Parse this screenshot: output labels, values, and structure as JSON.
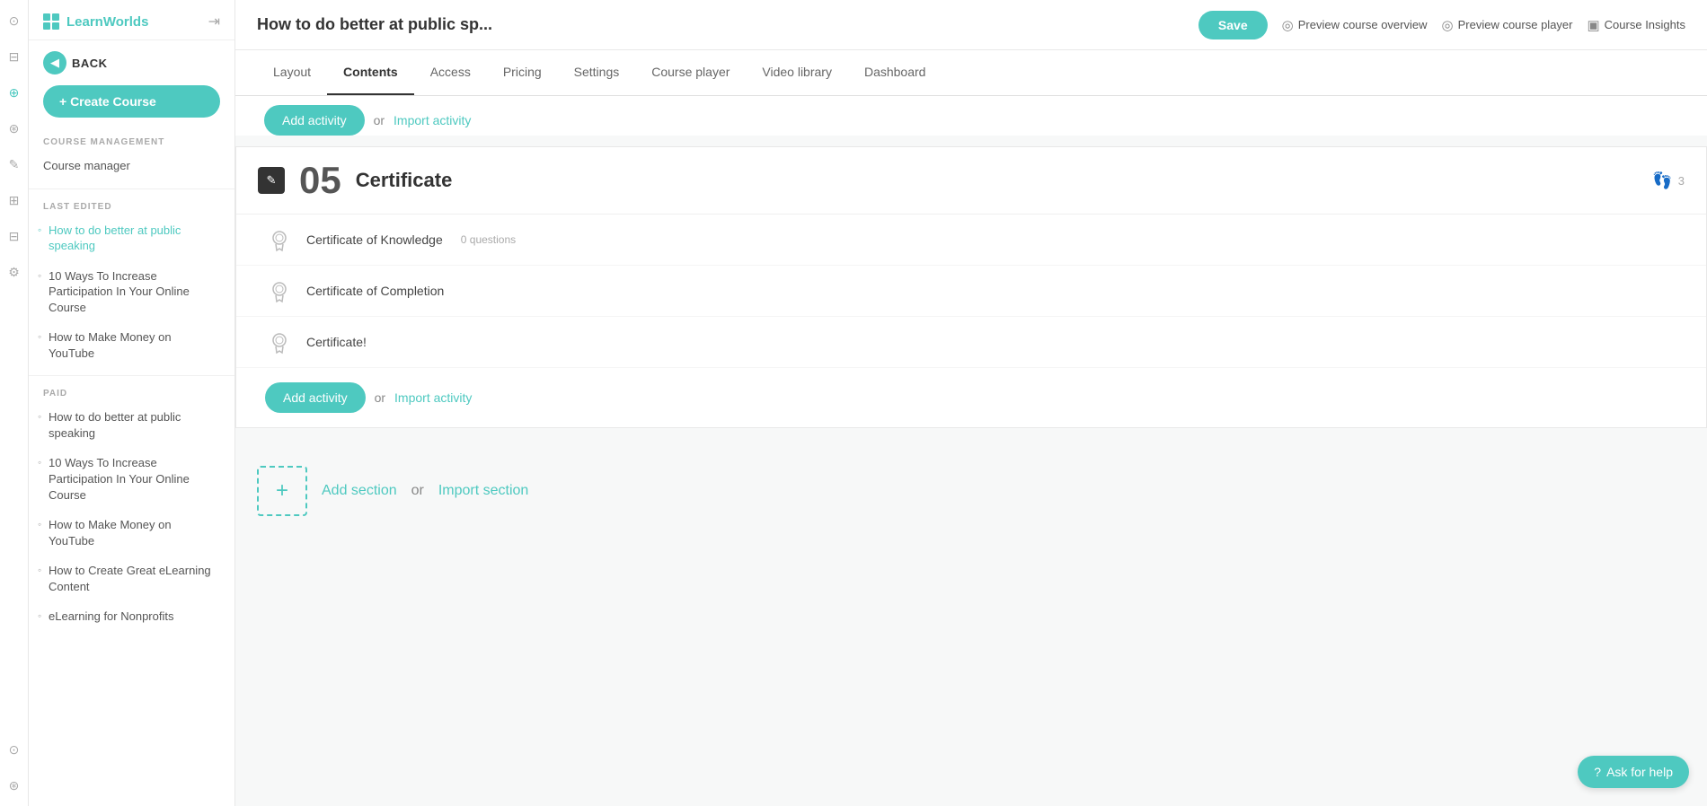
{
  "brand": {
    "name": "LearnWorlds",
    "logo_color": "#4ec9c0"
  },
  "sidebar": {
    "back_label": "BACK",
    "create_course_label": "+ Create Course",
    "course_management_label": "COURSE MANAGEMENT",
    "course_manager_label": "Course manager",
    "last_edited_label": "LAST EDITED",
    "paid_label": "PAID",
    "last_edited_items": [
      {
        "text": "How to do better at public speaking",
        "active": true
      },
      {
        "text": "10 Ways To Increase Participation In Your Online Course",
        "active": false
      },
      {
        "text": "How to Make Money on YouTube",
        "active": false
      }
    ],
    "paid_items": [
      {
        "text": "How to do better at public speaking"
      },
      {
        "text": "10 Ways To Increase Participation In Your Online Course"
      },
      {
        "text": "How to Make Money on YouTube"
      },
      {
        "text": "How to Create Great eLearning Content"
      },
      {
        "text": "eLearning for Nonprofits"
      }
    ]
  },
  "header": {
    "course_title": "How to do better at public sp...",
    "save_label": "Save",
    "preview_overview_label": "Preview course overview",
    "preview_player_label": "Preview course player",
    "course_insights_label": "Course Insights"
  },
  "nav_tabs": [
    {
      "label": "Layout",
      "active": false
    },
    {
      "label": "Contents",
      "active": true
    },
    {
      "label": "Access",
      "active": false
    },
    {
      "label": "Pricing",
      "active": false
    },
    {
      "label": "Settings",
      "active": false
    },
    {
      "label": "Course player",
      "active": false
    },
    {
      "label": "Video library",
      "active": false
    },
    {
      "label": "Dashboard",
      "active": false
    }
  ],
  "content": {
    "top_add_activity_label": "Add activity",
    "top_import_activity_label": "Import activity",
    "section": {
      "number": "05",
      "title": "Certificate",
      "footprints_count": "3",
      "activities": [
        {
          "name": "Certificate of Knowledge",
          "meta": "0 questions"
        },
        {
          "name": "Certificate of Completion",
          "meta": ""
        },
        {
          "name": "Certificate!",
          "meta": ""
        }
      ],
      "add_activity_label": "Add activity",
      "or_label": "or",
      "import_activity_label": "Import activity"
    },
    "add_section": {
      "add_label": "Add section",
      "or_label": "or",
      "import_label": "Import section"
    }
  },
  "ask_help": {
    "label": "Ask for help"
  }
}
